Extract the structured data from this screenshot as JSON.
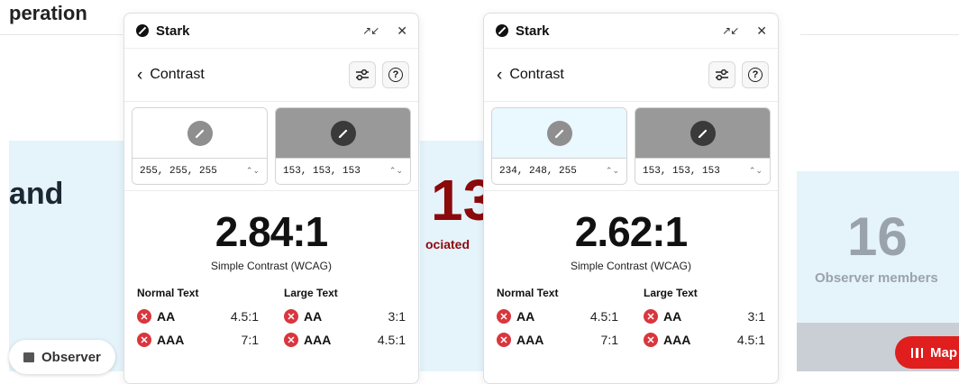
{
  "background": {
    "top_title": "peration",
    "heading": "and",
    "red_number": "13",
    "red_caption": "ociated",
    "observer_chip": "Observer",
    "observer_count": "16",
    "observer_caption": "Observer members",
    "map_button": "Map"
  },
  "panels": [
    {
      "title": "Stark",
      "nav_title": "Contrast",
      "foreground": {
        "value": "255, 255, 255",
        "color": "#ffffff"
      },
      "background": {
        "value": "153, 153, 153",
        "color": "#999999"
      },
      "ratio": "2.84:1",
      "ratio_label": "Simple Contrast (WCAG)",
      "normal_text": {
        "label": "Normal Text",
        "aa": "AA",
        "aa_req": "4.5:1",
        "aaa": "AAA",
        "aaa_req": "7:1"
      },
      "large_text": {
        "label": "Large Text",
        "aa": "AA",
        "aa_req": "3:1",
        "aaa": "AAA",
        "aaa_req": "4.5:1"
      }
    },
    {
      "title": "Stark",
      "nav_title": "Contrast",
      "foreground": {
        "value": "234, 248, 255",
        "color": "#eaf8ff"
      },
      "background": {
        "value": "153, 153, 153",
        "color": "#999999"
      },
      "ratio": "2.62:1",
      "ratio_label": "Simple Contrast (WCAG)",
      "normal_text": {
        "label": "Normal Text",
        "aa": "AA",
        "aa_req": "4.5:1",
        "aaa": "AAA",
        "aaa_req": "7:1"
      },
      "large_text": {
        "label": "Large Text",
        "aa": "AA",
        "aa_req": "3:1",
        "aaa": "AAA",
        "aaa_req": "4.5:1"
      }
    }
  ],
  "colors": {
    "fail": "#d9363e",
    "red_text": "#8b0a0a",
    "map_button": "#e01e1e",
    "panel_bg": "#e5f3fb"
  }
}
